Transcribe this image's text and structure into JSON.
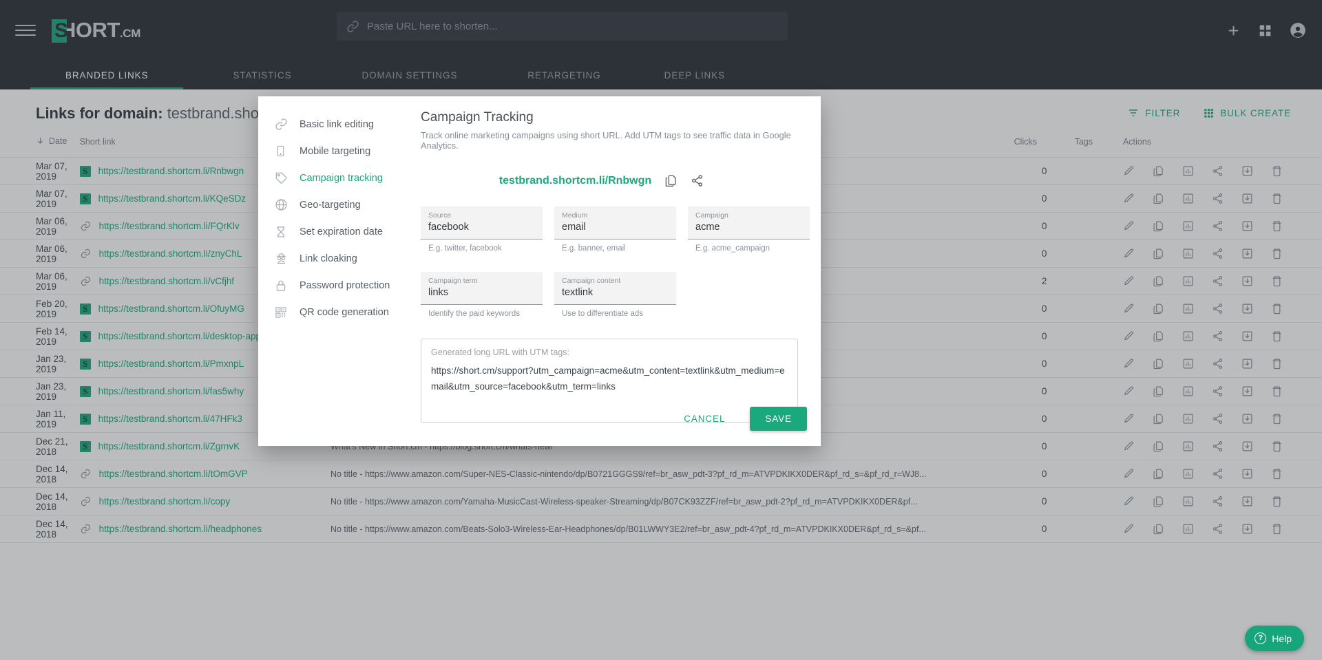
{
  "topbar": {
    "menu_icon": "hamburger-icon",
    "logo_mark": "S",
    "logo_short": "HORT",
    "logo_cm": ".CM",
    "url_input_placeholder": "Paste URL here to shorten...",
    "url_input_value": "",
    "add_icon": "plus-icon",
    "apps_icon": "grid-apps-icon",
    "account_icon": "account-avatar-icon"
  },
  "tabs": [
    {
      "label": "BRANDED LINKS",
      "active": true
    },
    {
      "label": "STATISTICS",
      "active": false
    },
    {
      "label": "DOMAIN SETTINGS",
      "active": false
    },
    {
      "label": "RETARGETING",
      "active": false
    },
    {
      "label": "DEEP LINKS",
      "active": false
    }
  ],
  "page": {
    "title_prefix": "Links for domain:",
    "title_domain": "testbrand.shortcm.li",
    "filter_label": "FILTER",
    "bulk_create_label": "BULK CREATE"
  },
  "table": {
    "headers": [
      "Date",
      "Short link",
      "",
      "Clicks",
      "Tags",
      "Actions"
    ],
    "rows": [
      {
        "date": "Mar 07, 2019",
        "icon": "favicon-s",
        "short": "https://testbrand.shortcm.li/Rnbwgn",
        "original": "",
        "clicks": "0"
      },
      {
        "date": "Mar 07, 2019",
        "icon": "favicon-s",
        "short": "https://testbrand.shortcm.li/KQeSDz",
        "original": "",
        "clicks": "0"
      },
      {
        "date": "Mar 06, 2019",
        "icon": "chain-link",
        "short": "https://testbrand.shortcm.li/FQrKlv",
        "original": "",
        "clicks": "0"
      },
      {
        "date": "Mar 06, 2019",
        "icon": "chain-link",
        "short": "https://testbrand.shortcm.li/znyChL",
        "original": "",
        "clicks": "0"
      },
      {
        "date": "Mar 06, 2019",
        "icon": "chain-link",
        "short": "https://testbrand.shortcm.li/vCfjhf",
        "original": "",
        "clicks": "2"
      },
      {
        "date": "Feb 20, 2019",
        "icon": "favicon-s",
        "short": "https://testbrand.shortcm.li/OfuyMG",
        "original": "",
        "clicks": "0"
      },
      {
        "date": "Feb 14, 2019",
        "icon": "favicon-s",
        "short": "https://testbrand.shortcm.li/desktop-app",
        "original": "",
        "clicks": "0"
      },
      {
        "date": "Jan 23, 2019",
        "icon": "favicon-s",
        "short": "https://testbrand.shortcm.li/PmxnpL",
        "original": "",
        "clicks": "0"
      },
      {
        "date": "Jan 23, 2019",
        "icon": "favicon-s",
        "short": "https://testbrand.shortcm.li/fas5why",
        "original": "",
        "clicks": "0"
      },
      {
        "date": "Jan 11, 2019",
        "icon": "favicon-s",
        "short": "https://testbrand.shortcm.li/47HFk3",
        "original": "",
        "clicks": "0"
      },
      {
        "date": "Dec 21, 2018",
        "icon": "favicon-s",
        "short": "https://testbrand.shortcm.li/ZgrnvK",
        "original": "What's New in Short.cm - https://blog.short.cm/whats-new/",
        "clicks": "0"
      },
      {
        "date": "Dec 14, 2018",
        "icon": "chain-link",
        "short": "https://testbrand.shortcm.li/tOmGVP",
        "original": "No title - https://www.amazon.com/Super-NES-Classic-nintendo/dp/B0721GGGS9/ref=br_asw_pdt-3?pf_rd_m=ATVPDKIKX0DER&pf_rd_s=&pf_rd_r=WJ8...",
        "clicks": "0"
      },
      {
        "date": "Dec 14, 2018",
        "icon": "chain-link",
        "short": "https://testbrand.shortcm.li/copy",
        "original": "No title - https://www.amazon.com/Yamaha-MusicCast-Wireless-speaker-Streaming/dp/B07CK93ZZF/ref=br_asw_pdt-2?pf_rd_m=ATVPDKIKX0DER&pf...",
        "clicks": "0"
      },
      {
        "date": "Dec 14, 2018",
        "icon": "chain-link",
        "short": "https://testbrand.shortcm.li/headphones",
        "original": "No title - https://www.amazon.com/Beats-Solo3-Wireless-Ear-Headphones/dp/B01LWWY3E2/ref=br_asw_pdt-4?pf_rd_m=ATVPDKIKX0DER&pf_rd_s=&pf...",
        "clicks": "0"
      }
    ],
    "row_actions": [
      "edit-pencil-icon",
      "duplicate-icon",
      "statistics-bar-icon",
      "share-icon",
      "archive-icon",
      "delete-trash-icon"
    ]
  },
  "modal": {
    "sidebar": [
      {
        "label": "Basic link editing",
        "icon": "chain-link-icon",
        "active": false
      },
      {
        "label": "Mobile targeting",
        "icon": "mobile-phone-icon",
        "active": false
      },
      {
        "label": "Campaign tracking",
        "icon": "tag-icon",
        "active": true
      },
      {
        "label": "Geo-targeting",
        "icon": "globe-icon",
        "active": false
      },
      {
        "label": "Set expiration date",
        "icon": "hourglass-icon",
        "active": false
      },
      {
        "label": "Link cloaking",
        "icon": "spy-incognito-icon",
        "active": false
      },
      {
        "label": "Password protection",
        "icon": "lock-icon",
        "active": false
      },
      {
        "label": "QR code generation",
        "icon": "qr-code-icon",
        "active": false
      }
    ],
    "title": "Campaign Tracking",
    "subtitle": "Track online marketing campaigns using short URL. Add UTM tags to see traffic data in Google Analytics.",
    "short_url": "testbrand.shortcm.li/Rnbwgn",
    "copy_icon": "copy-icon",
    "share_icon": "share-icon",
    "fields": [
      {
        "label": "Source",
        "value": "facebook",
        "help": "E.g. twitter, facebook"
      },
      {
        "label": "Medium",
        "value": "email",
        "help": "E.g. banner, email"
      },
      {
        "label": "Campaign",
        "value": "acme",
        "help": "E.g. acme_campaign"
      },
      {
        "label": "Campaign term",
        "value": "links",
        "help": "Identify the paid keywords"
      },
      {
        "label": "Campaign content",
        "value": "textlink",
        "help": "Use to differentiate ads"
      }
    ],
    "generated_label": "Generated long URL with UTM tags:",
    "generated_url": "https://short.cm/support?utm_campaign=acme&utm_content=textlink&utm_medium=email&utm_source=facebook&utm_term=links",
    "cancel_label": "CANCEL",
    "save_label": "SAVE"
  },
  "help_widget": {
    "label": "Help",
    "icon": "question-mark-icon"
  },
  "colors": {
    "brand_green": "#17a67b",
    "dark_nav": "#252b33",
    "accent_green": "#1aa87c"
  }
}
